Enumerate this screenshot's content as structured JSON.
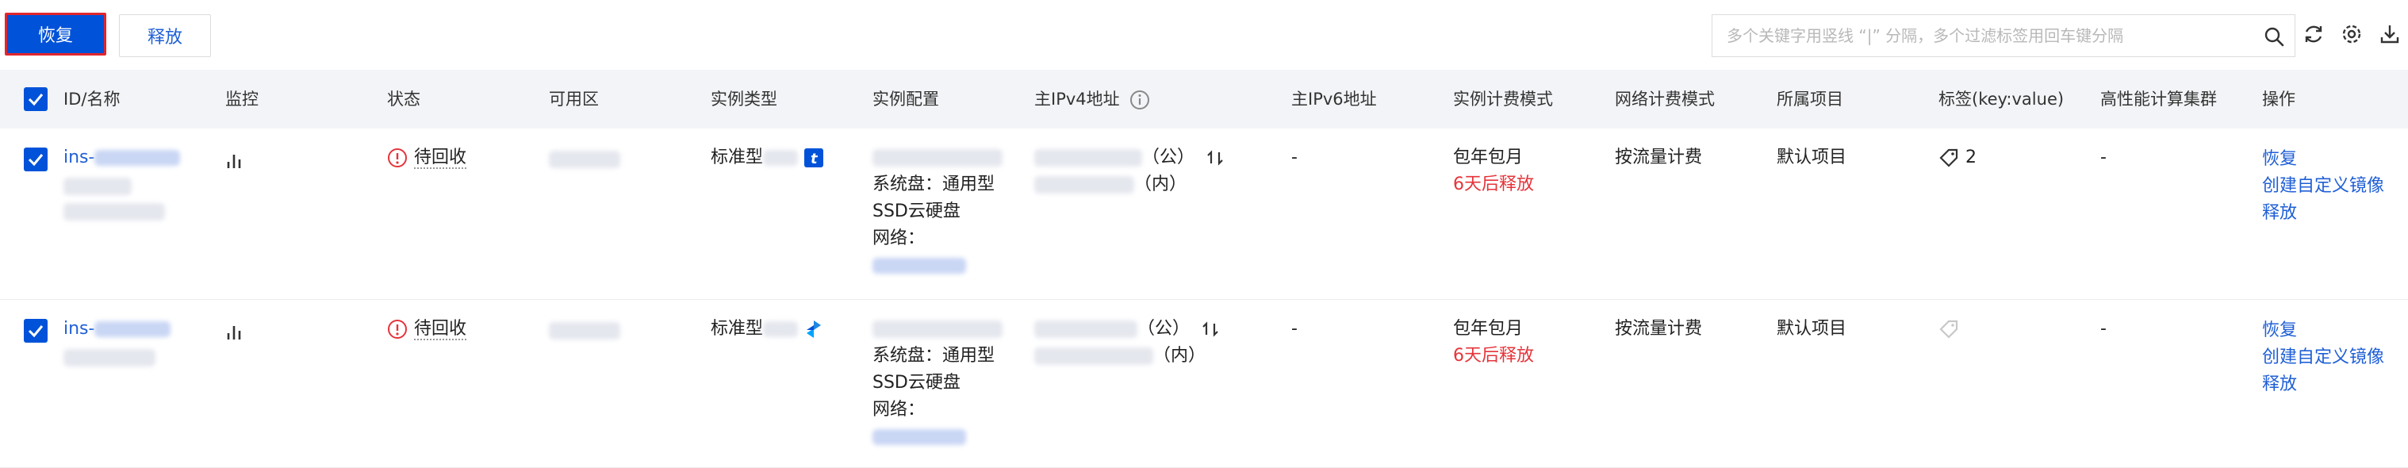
{
  "toolbar": {
    "restore_label": "恢复",
    "release_label": "释放",
    "search_placeholder": "多个关键字用竖线 “|” 分隔，多个过滤标签用回车键分隔"
  },
  "table": {
    "headers": {
      "id_name": "ID/名称",
      "monitor": "监控",
      "status": "状态",
      "zone": "可用区",
      "instance_type": "实例类型",
      "instance_config": "实例配置",
      "ipv4": "主IPv4地址",
      "ipv6": "主IPv6地址",
      "billing_mode": "实例计费模式",
      "network_billing": "网络计费模式",
      "project": "所属项目",
      "tags": "标签(key:value)",
      "hpc_cluster": "高性能计算集群",
      "actions": "操作"
    },
    "rows": [
      {
        "id_prefix": "ins-",
        "status": "待回收",
        "type_prefix": "标准型",
        "system_disk": "系统盘：通用型",
        "disk_type": "SSD云硬盘",
        "network_label": "网络：",
        "ip_public_suffix": "（公）",
        "ip_private_suffix": "（内）",
        "ipv6": "-",
        "billing_mode": "包年包月",
        "release_note": "6天后释放",
        "network_billing": "按流量计费",
        "project": "默认项目",
        "tag_count": "2",
        "hpc_cluster": "-",
        "action_restore": "恢复",
        "action_image": "创建自定义镜像",
        "action_release": "释放"
      },
      {
        "id_prefix": "ins-",
        "status": "待回收",
        "type_prefix": "标准型",
        "system_disk": "系统盘：通用型",
        "disk_type": "SSD云硬盘",
        "network_label": "网络：",
        "ip_public_suffix": "（公）",
        "ip_private_suffix": "（内）",
        "ipv6": "-",
        "billing_mode": "包年包月",
        "release_note": "6天后释放",
        "network_billing": "按流量计费",
        "project": "默认项目",
        "tag_count": "",
        "hpc_cluster": "-",
        "action_restore": "恢复",
        "action_image": "创建自定义镜像",
        "action_release": "释放"
      }
    ]
  },
  "colors": {
    "primary": "#0052d9",
    "link": "#1f5fd6",
    "danger": "#e5343a",
    "header_bg": "#f3f4f7"
  }
}
